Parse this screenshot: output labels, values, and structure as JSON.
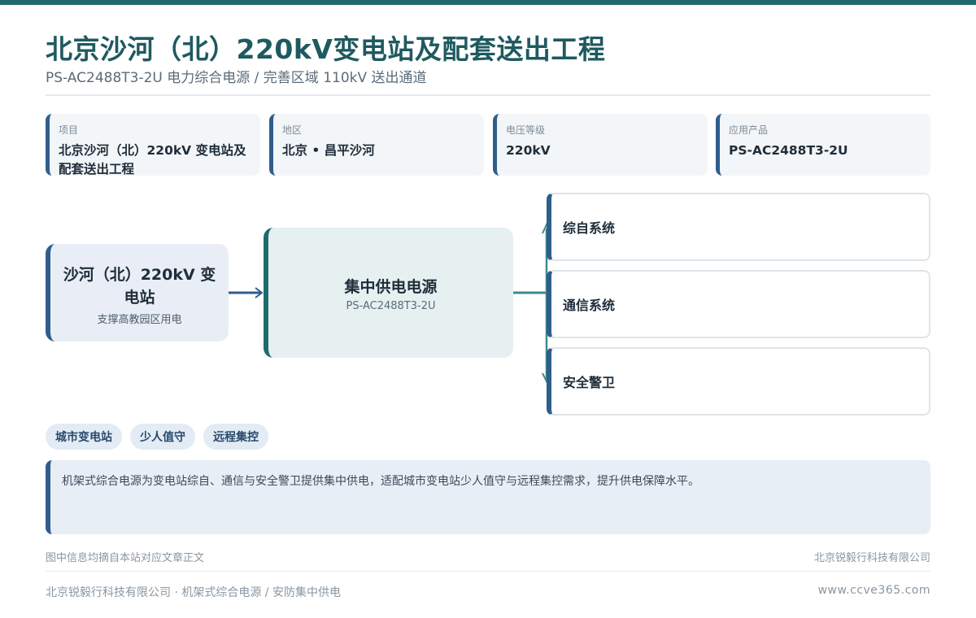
{
  "header": {
    "title": "北京沙河（北）220kV变电站及配套送出工程",
    "subtitle": "PS-AC2488T3-2U 电力综合电源 / 完善区域 110kV 送出通道"
  },
  "info_cards": [
    {
      "label": "项目",
      "value": "北京沙河（北）220kV 变电站及配套送出工程"
    },
    {
      "label": "地区",
      "value": "北京 • 昌平沙河"
    },
    {
      "label": "电压等级",
      "value": "220kV"
    },
    {
      "label": "应用产品",
      "value": "PS-AC2488T3-2U"
    }
  ],
  "diagram": {
    "source": {
      "name": "沙河（北）220kV 变电站",
      "desc": "支撑高教园区用电"
    },
    "center": {
      "name": "集中供电电源",
      "model": "PS-AC2488T3-2U"
    },
    "outputs": [
      {
        "label": "综自系统"
      },
      {
        "label": "通信系统"
      },
      {
        "label": "安全警卫"
      }
    ]
  },
  "tags": [
    "城市变电站",
    "少人值守",
    "远程集控"
  ],
  "note": "机架式综合电源为变电站综自、通信与安全警卫提供集中供电，适配城市变电站少人值守与远程集控需求，提升供电保障水平。",
  "footer": {
    "source_note": "图中信息均摘自本站对应文章正文",
    "company_right": "北京锐毅行科技有限公司",
    "left": "北京锐毅行科技有限公司 · 机架式综合电源 / 安防集中供电",
    "right": "www.ccve365.com"
  },
  "colors": {
    "title": "#1e5a60",
    "accent_teal": "#1e6a6e",
    "accent_blue": "#2f5e8c"
  }
}
